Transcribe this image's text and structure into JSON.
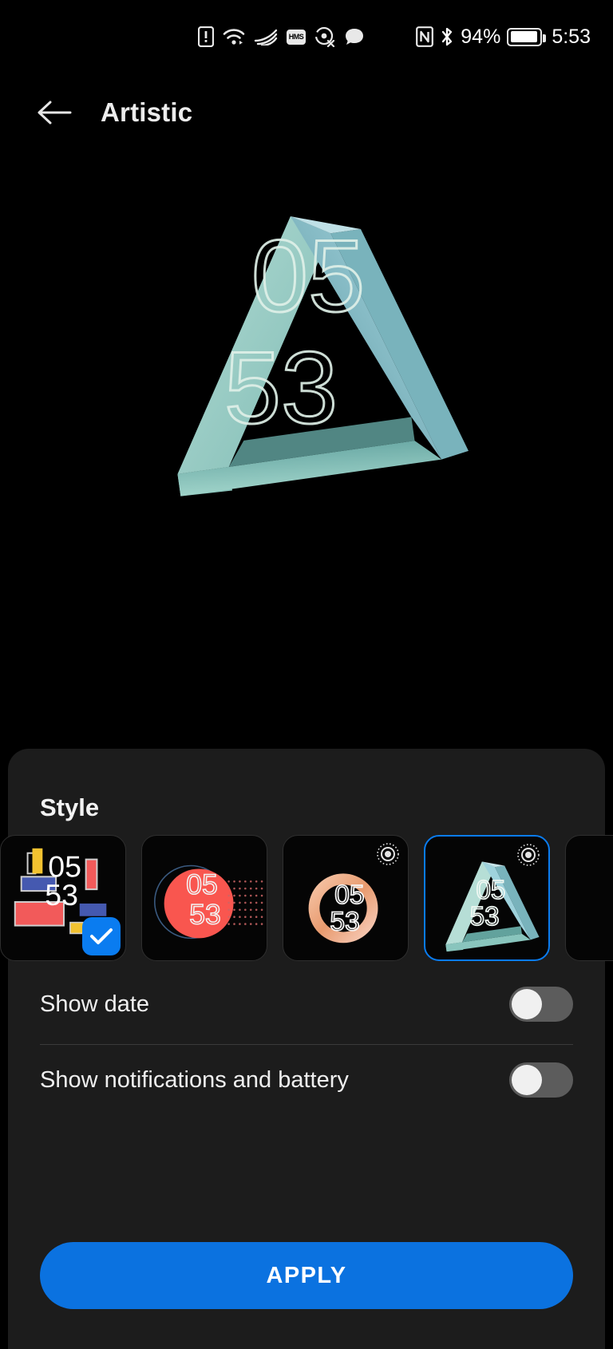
{
  "status_bar": {
    "icons": [
      "sim-alert-icon",
      "wifi-icon",
      "huawei-share-icon",
      "hms-icon",
      "location-off-icon",
      "message-icon"
    ],
    "hms_label": "HMS",
    "nfc_label": "N",
    "battery_percent": "94%",
    "battery_level": 94,
    "time": "5:53"
  },
  "appbar": {
    "back_label": "back-arrow",
    "title": "Artistic"
  },
  "preview": {
    "hours": "05",
    "minutes": "53",
    "shape": "penrose-triangle",
    "color": "#8fcfc4"
  },
  "sheet": {
    "style_heading": "Style",
    "cards": [
      {
        "name": "blocks-style",
        "art": "blocks",
        "hours": "05",
        "minutes": "53",
        "selected_badge": true,
        "aod_badge": false,
        "is_selected": false
      },
      {
        "name": "circle-style",
        "art": "circle",
        "hours": "05",
        "minutes": "53",
        "selected_badge": false,
        "aod_badge": false,
        "is_selected": false,
        "color": "#f9564f"
      },
      {
        "name": "torus-style",
        "art": "torus",
        "hours": "05",
        "minutes": "53",
        "selected_badge": false,
        "aod_badge": true,
        "is_selected": false,
        "color": "#f0b090"
      },
      {
        "name": "penrose-style",
        "art": "penrose",
        "hours": "05",
        "minutes": "53",
        "selected_badge": false,
        "aod_badge": true,
        "is_selected": true,
        "color": "#9fd8cd"
      },
      {
        "name": "next-style",
        "art": "empty",
        "hours": "",
        "minutes": "",
        "selected_badge": false,
        "aod_badge": false,
        "is_selected": false
      }
    ],
    "settings": [
      {
        "label": "Show date",
        "on": false
      },
      {
        "label": "Show notifications and battery",
        "on": false
      }
    ],
    "apply_label": "APPLY"
  },
  "colors": {
    "accent": "#0a7cf0",
    "apply_button": "#0b72e0",
    "sheet_bg": "#1c1c1c",
    "page_bg": "#000000",
    "toggle_off_track": "#5c5c5c",
    "toggle_knob": "#f0f0f0"
  }
}
